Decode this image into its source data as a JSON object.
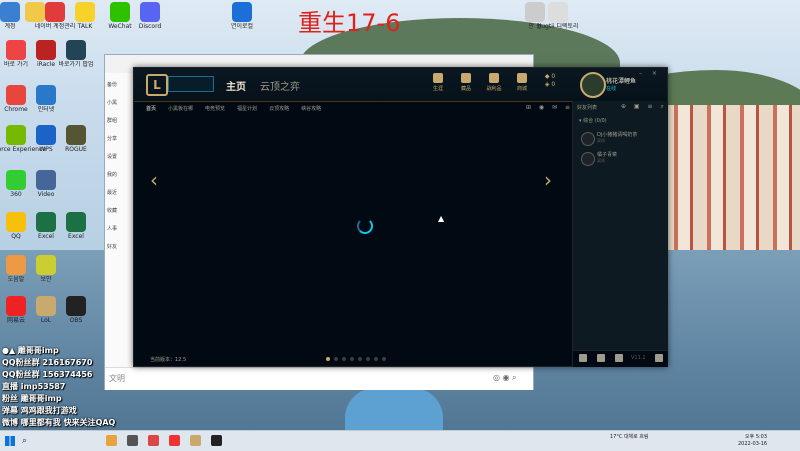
{
  "overlay_title": "重生17-6",
  "desktop_icons": [
    {
      "label": "계정",
      "color": "#3b7fd0"
    },
    {
      "label": "",
      "color": "#f0c94a"
    },
    {
      "label": "네이버 계정관리",
      "color": "#e03c3c"
    },
    {
      "label": "TALK",
      "color": "#f6d22a"
    },
    {
      "label": "WeChat",
      "color": "#2dc100"
    },
    {
      "label": "Discord",
      "color": "#5865f2"
    },
    {
      "label": "연이로컬",
      "color": "#1d6fd8"
    },
    {
      "label": "",
      "color": "#e04b3a"
    },
    {
      "label": "",
      "color": "#c33"
    },
    {
      "label": "안 선",
      "color": "#ccc"
    },
    {
      "label": "bugtii 디렉토리",
      "color": "#ddd"
    },
    {
      "label": "바로 가기",
      "color": "#e44"
    },
    {
      "label": "iRacle",
      "color": "#b22"
    },
    {
      "label": "바로가기 팝업",
      "color": "#245"
    },
    {
      "label": "Chrome",
      "color": "#e8453c"
    },
    {
      "label": "인터넷",
      "color": "#2a78c8"
    },
    {
      "label": "GeForce Experience",
      "color": "#76b900"
    },
    {
      "label": "WPS",
      "color": "#1a64c8"
    },
    {
      "label": "ROGUE",
      "color": "#553"
    },
    {
      "label": "360",
      "color": "#3c3"
    },
    {
      "label": "Video",
      "color": "#469"
    },
    {
      "label": "QQ",
      "color": "#f7c00b"
    },
    {
      "label": "Excel",
      "color": "#1d7044"
    },
    {
      "label": "Excel",
      "color": "#1d7044"
    },
    {
      "label": "도움말",
      "color": "#e94"
    },
    {
      "label": "보안",
      "color": "#cc3"
    },
    {
      "label": "网易云",
      "color": "#e22"
    },
    {
      "label": "LoL",
      "color": "#c8aa6e"
    },
    {
      "label": "OBS",
      "color": "#222"
    }
  ],
  "chat_window": {
    "left_items": [
      "备份",
      "小黑",
      "群组",
      "分享",
      "设置",
      "我的",
      "最近",
      "收藏",
      "人事",
      "好友"
    ],
    "bottom_text": "文明"
  },
  "lol_client": {
    "logo": "L",
    "tabs": {
      "home": "主页",
      "tft": "云顶之弈"
    },
    "top_icons": [
      "生涯",
      "藏品",
      "战利品",
      "商城"
    ],
    "currency": {
      "be": "0",
      "rp": "0"
    },
    "user": {
      "name": "桃花潭鲤鱼",
      "status": "在线"
    },
    "window_controls": "– ×",
    "subnav": [
      "首页",
      "小黑板在哪",
      "电竞预览",
      "福星计划",
      "云顶攻略",
      "峡谷攻略"
    ],
    "subnav_active_index": 0,
    "subnav_icons": "⊞ ◉ ✉ ≡",
    "arrows": {
      "left": "‹",
      "right": "›"
    },
    "version": "当前版本：12.5",
    "carousel_dots": 8,
    "carousel_active": 0,
    "social": {
      "header": "好友列表",
      "icons": "⊕ ▣ ≡ ⌕",
      "group": "▾ 综合 (0/0)",
      "friends": [
        {
          "name": "DJ小猪猪请喝奶茶",
          "status": "离线"
        },
        {
          "name": "橘子青菜",
          "status": "离线"
        }
      ],
      "footer_version": "V11.1"
    }
  },
  "stream_overlay": [
    "●▲ 雕哥哥imp",
    "QQ粉丝群 216167670",
    "QQ粉丝群 156374456",
    "直播 imp53587",
    "粉丝 雕哥哥imp",
    "弹幕 鸡鸡跟我打游戏",
    "微博 哪里都有我 快来关注QAQ"
  ],
  "taskbar": {
    "search_icon": "search-icon",
    "apps": [
      "#e8a33d",
      "#555",
      "#d44",
      "#e33",
      "#c8aa6e",
      "#222"
    ],
    "tray": "17°C 대체로 흐림",
    "time": "오후 5:03",
    "date": "2022-03-16"
  }
}
